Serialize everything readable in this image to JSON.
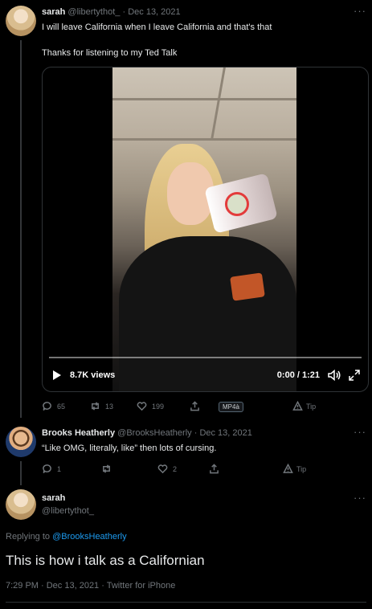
{
  "tweet1": {
    "name": "sarah",
    "handle": "@libertythot_",
    "dot": "·",
    "date": "Dec 13, 2021",
    "line1": "I will leave California when I leave California and that's that",
    "line2": "Thanks for listening to my Ted Talk",
    "video": {
      "views": "8.7K views",
      "time": "0:00 / 1:21",
      "progress": 0.0
    },
    "actions": {
      "replies": "65",
      "retweets": "13",
      "likes": "199",
      "badge": "MP4à",
      "tip": "Tip"
    }
  },
  "reply": {
    "name": "Brooks Heatherly",
    "handle": "@BrooksHeatherly",
    "dot": "·",
    "date": "Dec 13, 2021",
    "text": "“Like OMG, literally, like” then lots of cursing.",
    "actions": {
      "replies": "1",
      "retweets": "",
      "likes": "2",
      "tip": "Tip"
    }
  },
  "main": {
    "name": "sarah",
    "handle": "@libertythot_",
    "replying_prefix": "Replying to ",
    "replying_to": "@BrooksHeatherly",
    "text": "This is how i talk as a Californian",
    "meta": "7:29 PM · Dec 13, 2021 · Twitter for iPhone"
  },
  "more_label": "···",
  "colors": {
    "background": "#000000",
    "text": "#e7e9ea",
    "muted": "#71767b",
    "link": "#1d9bf0",
    "border": "#2f3336"
  }
}
